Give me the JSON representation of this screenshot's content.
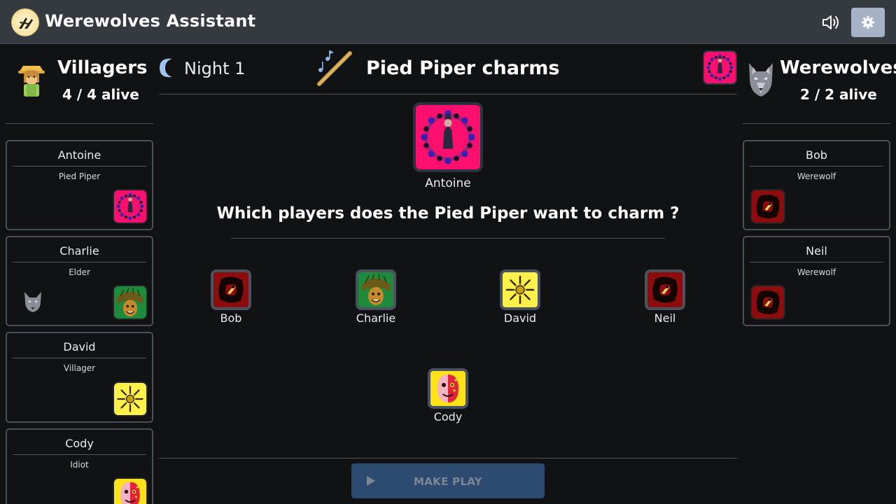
{
  "app": {
    "title": "Werewolves Assistant"
  },
  "header": {
    "sound_icon": "speaker-icon",
    "settings_icon": "gear-icon"
  },
  "villagers": {
    "title": "Villagers",
    "alive": "4 / 4 alive",
    "players": [
      {
        "name": "Antoine",
        "role": "Pied Piper",
        "icon": "pied-piper"
      },
      {
        "name": "Charlie",
        "role": "Elder",
        "icon": "elder",
        "marker": "werewolf-mark"
      },
      {
        "name": "David",
        "role": "Villager",
        "icon": "villager"
      },
      {
        "name": "Cody",
        "role": "Idiot",
        "icon": "idiot"
      }
    ]
  },
  "werewolves": {
    "title": "Werewolves",
    "alive": "2 / 2 alive",
    "players": [
      {
        "name": "Bob",
        "role": "Werewolf",
        "icon": "werewolf"
      },
      {
        "name": "Neil",
        "role": "Werewolf",
        "icon": "werewolf"
      }
    ]
  },
  "phase": {
    "label": "Night 1",
    "action": "Pied Piper charms",
    "actor": "Antoine",
    "question": "Which players does the Pied Piper want to charm ?"
  },
  "targets": [
    {
      "name": "Bob",
      "icon": "werewolf"
    },
    {
      "name": "Charlie",
      "icon": "elder"
    },
    {
      "name": "David",
      "icon": "villager"
    },
    {
      "name": "Neil",
      "icon": "werewolf"
    },
    {
      "name": "Cody",
      "icon": "idiot"
    }
  ],
  "play_button": {
    "label": "MAKE PLAY"
  },
  "colors": {
    "background": "#111213",
    "topbar": "#343a40",
    "button_disabled": "#2d4a70",
    "settings": "#a6b3c7"
  }
}
